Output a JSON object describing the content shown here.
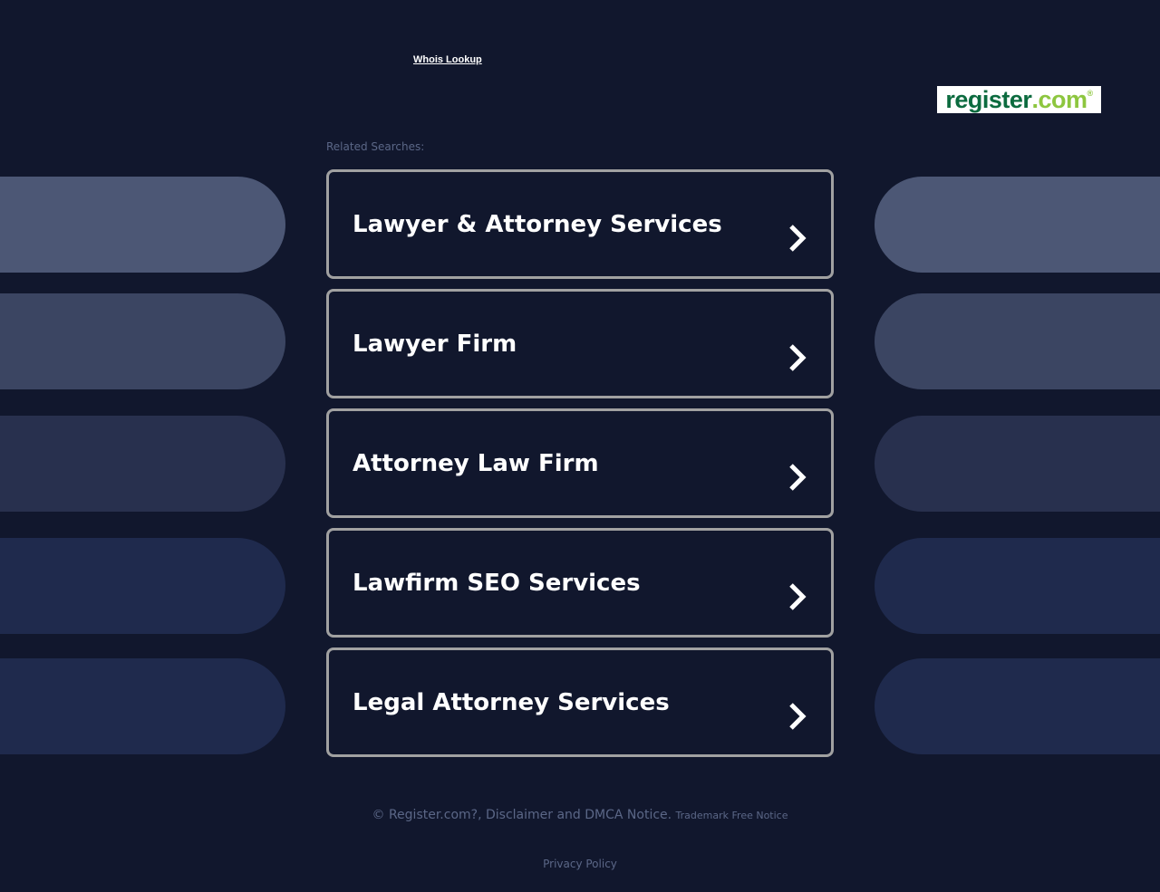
{
  "header": {
    "whois_link": "Whois Lookup",
    "logo": {
      "main": "register",
      "domain": ".com",
      "mark": "®"
    }
  },
  "related_label": "Related Searches:",
  "searches": [
    "Lawyer & Attorney Services",
    "Lawyer Firm",
    "Attorney Law Firm",
    "Lawfirm SEO Services",
    "Legal Attorney Services"
  ],
  "footer": {
    "copyright": "© Register.com?, Disclaimer and DMCA Notice.",
    "trademark": "Trademark Free Notice",
    "privacy": "Privacy Policy"
  },
  "colors": {
    "background": "#11172d",
    "card_border": "#a1a1a1",
    "pill_shades": [
      "#4c5775",
      "#3b4562",
      "#28304e",
      "#1f2a4d",
      "#1f2a4d"
    ]
  },
  "icons": {
    "card_arrow": "chevron-right-icon"
  }
}
